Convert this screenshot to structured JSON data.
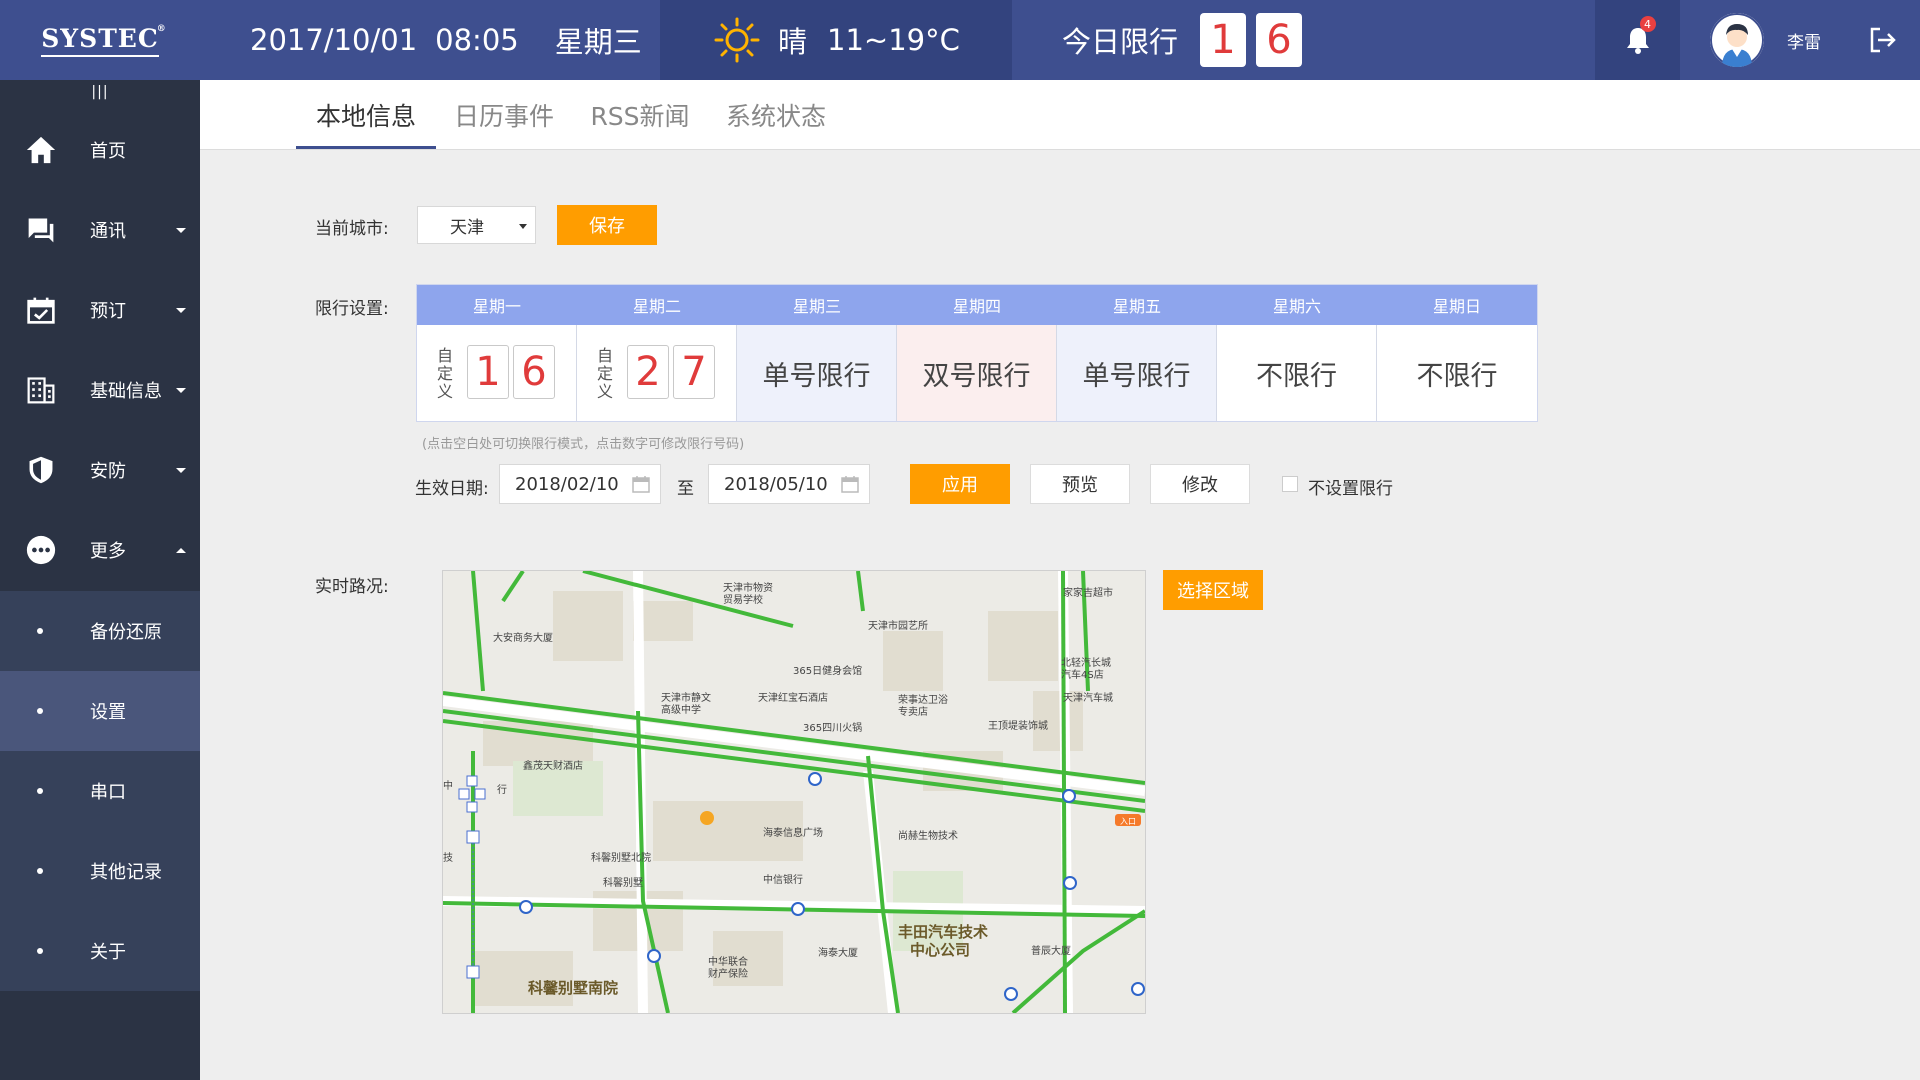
{
  "header": {
    "logo": "SYSTEC",
    "logo_mark": "®",
    "date": "2017/10/01",
    "time": "08:05",
    "weekday": "星期三",
    "weather": "晴",
    "temp": "11~19°C",
    "limit_label": "今日限行",
    "limit_digits": [
      "1",
      "6"
    ],
    "notification_count": "4",
    "username": "李雷"
  },
  "sidebar": {
    "collapse": "|||",
    "items": [
      {
        "label": "首页",
        "icon": "home-icon"
      },
      {
        "label": "通讯",
        "icon": "chat-icon"
      },
      {
        "label": "预订",
        "icon": "calendar-icon"
      },
      {
        "label": "基础信息",
        "icon": "building-icon"
      },
      {
        "label": "安防",
        "icon": "shield-icon"
      },
      {
        "label": "更多",
        "icon": "more-icon"
      }
    ],
    "sub_items": [
      "备份还原",
      "设置",
      "串口",
      "其他记录",
      "关于"
    ],
    "active_sub": "设置"
  },
  "tabs": [
    "本地信息",
    "日历事件",
    "RSS新闻",
    "系统状态"
  ],
  "active_tab": "本地信息",
  "form": {
    "city_label": "当前城市:",
    "city_value": "天津",
    "save_label": "保存",
    "limit_label": "限行设置:",
    "weekdays": [
      "星期一",
      "星期二",
      "星期三",
      "星期四",
      "星期五",
      "星期六",
      "星期日"
    ],
    "custom_label": "自定义",
    "custom_mon": [
      "1",
      "6"
    ],
    "custom_tue": [
      "2",
      "7"
    ],
    "rules": [
      "单号限行",
      "双号限行",
      "单号限行",
      "不限行",
      "不限行"
    ],
    "hint": "(点击空白处可切换限行模式，点击数字可修改限行号码)",
    "effective_label": "生效日期:",
    "date_from": "2018/02/10",
    "to_label": "至",
    "date_to": "2018/05/10",
    "apply_label": "应用",
    "preview_label": "预览",
    "modify_label": "修改",
    "no_limit_label": "不设置限行",
    "traffic_label": "实时路况:",
    "select_area_label": "选择区域"
  },
  "map": {
    "places": [
      "天津市物资贸易学校",
      "天津市园艺所",
      "家家吉超市",
      "大安商务大厦",
      "365日健身会馆",
      "北轻汽长城汽车4S店",
      "天津市静文高级中学",
      "天津红宝石酒店",
      "荣事达卫浴专卖店",
      "天津汽车城",
      "365四川火锅",
      "王顶堤装饰城",
      "鑫茂天财酒店",
      "海泰信息广场",
      "尚赫生物技术",
      "科馨别墅北院",
      "中信银行",
      "科馨别墅",
      "丰田汽车技术中心公司",
      "中华联合财产保险",
      "海泰大厦",
      "普辰大厦",
      "科馨别墅南院",
      "入口",
      "中",
      "行",
      "技"
    ]
  },
  "colors": {
    "header": "#3e4f8f",
    "sidebar": "#2b3344",
    "accent": "#ff9d00",
    "table_head": "#8ea5ed",
    "limit_digit": "#e03b3b",
    "road": "#43b93a"
  }
}
